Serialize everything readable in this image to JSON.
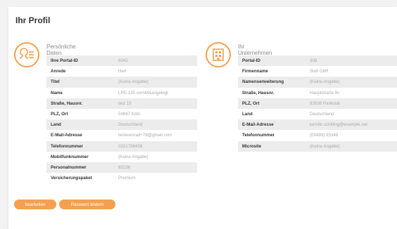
{
  "page": {
    "title": "Ihr Profil"
  },
  "personal": {
    "title": "Persönliche Daten",
    "icon": "user-info-icon",
    "rows": [
      {
        "label": "Ihre Portal-ID",
        "value": "6042"
      },
      {
        "label": "Anrede",
        "value": "Herr"
      },
      {
        "label": "Titel",
        "value": "(Keine Angabe)"
      },
      {
        "label": "Name",
        "value": "LPE-135 vornMAangelegt"
      },
      {
        "label": "Straße, Hausnr.",
        "value": "test 15"
      },
      {
        "label": "PLZ, Ort",
        "value": "50667 Köln"
      },
      {
        "label": "Land",
        "value": "Deutschland"
      },
      {
        "label": "E-Mail-Adresse",
        "value": "testeurorad+78@gmail.com"
      },
      {
        "label": "Telefonnummer",
        "value": "0221789456"
      },
      {
        "label": "Mobilfunknummer",
        "value": "(Keine Angabe)"
      },
      {
        "label": "Personalnummer",
        "value": "85236"
      },
      {
        "label": "Versicherungspaket",
        "value": "Premium"
      }
    ]
  },
  "company": {
    "title": "Ihr Unternehmen",
    "icon": "building-icon",
    "rows": [
      {
        "label": "Portal-ID",
        "value": "308"
      },
      {
        "label": "Firmenname",
        "value": "Stoll GbR"
      },
      {
        "label": "Namenserweiterung",
        "value": "(Keine Angabe)"
      },
      {
        "label": "Straße, Hausnr.",
        "value": "Hauptstraße 9c"
      },
      {
        "label": "PLZ, Ort",
        "value": "82636 Pankstal"
      },
      {
        "label": "Land",
        "value": "Deutschland"
      },
      {
        "label": "E-Mail-Adresse",
        "value": "kerstin.schilling@example.net"
      },
      {
        "label": "Telefonnummer",
        "value": "(09499) 35349"
      },
      {
        "label": "Microsite",
        "value": "(Keine Angabe)"
      }
    ]
  },
  "actions": {
    "edit_label": "bearbeiten",
    "password_label": "Passwort ändern"
  },
  "colors": {
    "accent": "#f5a04e",
    "row_alt": "#ececec"
  }
}
